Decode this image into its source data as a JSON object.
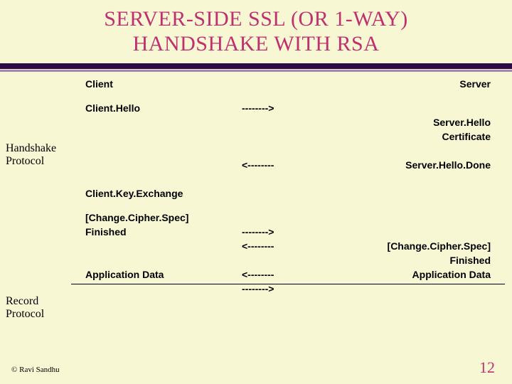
{
  "title_line1": "SERVER-SIDE SSL (OR 1-WAY)",
  "title_line2": "HANDSHAKE WITH RSA",
  "labels": {
    "handshake_l1": "Handshake",
    "handshake_l2": "Protocol",
    "record_l1": "Record",
    "record_l2": "Protocol"
  },
  "headers": {
    "client": "Client",
    "server": "Server"
  },
  "arrows": {
    "right": "-------->",
    "left": "<--------"
  },
  "messages": {
    "client_hello": "Client.Hello",
    "server_hello": "Server.Hello",
    "certificate": "Certificate",
    "server_hello_done": "Server.Hello.Done",
    "client_key_exchange": "Client.Key.Exchange",
    "change_cipher_c": "[Change.Cipher.Spec]",
    "finished_c": "Finished",
    "change_cipher_s": "[Change.Cipher.Spec]",
    "finished_s": "Finished",
    "app_data_c": "Application Data",
    "app_data_s": "Application Data"
  },
  "footer": {
    "copyright": "© Ravi Sandhu",
    "page": "12"
  }
}
